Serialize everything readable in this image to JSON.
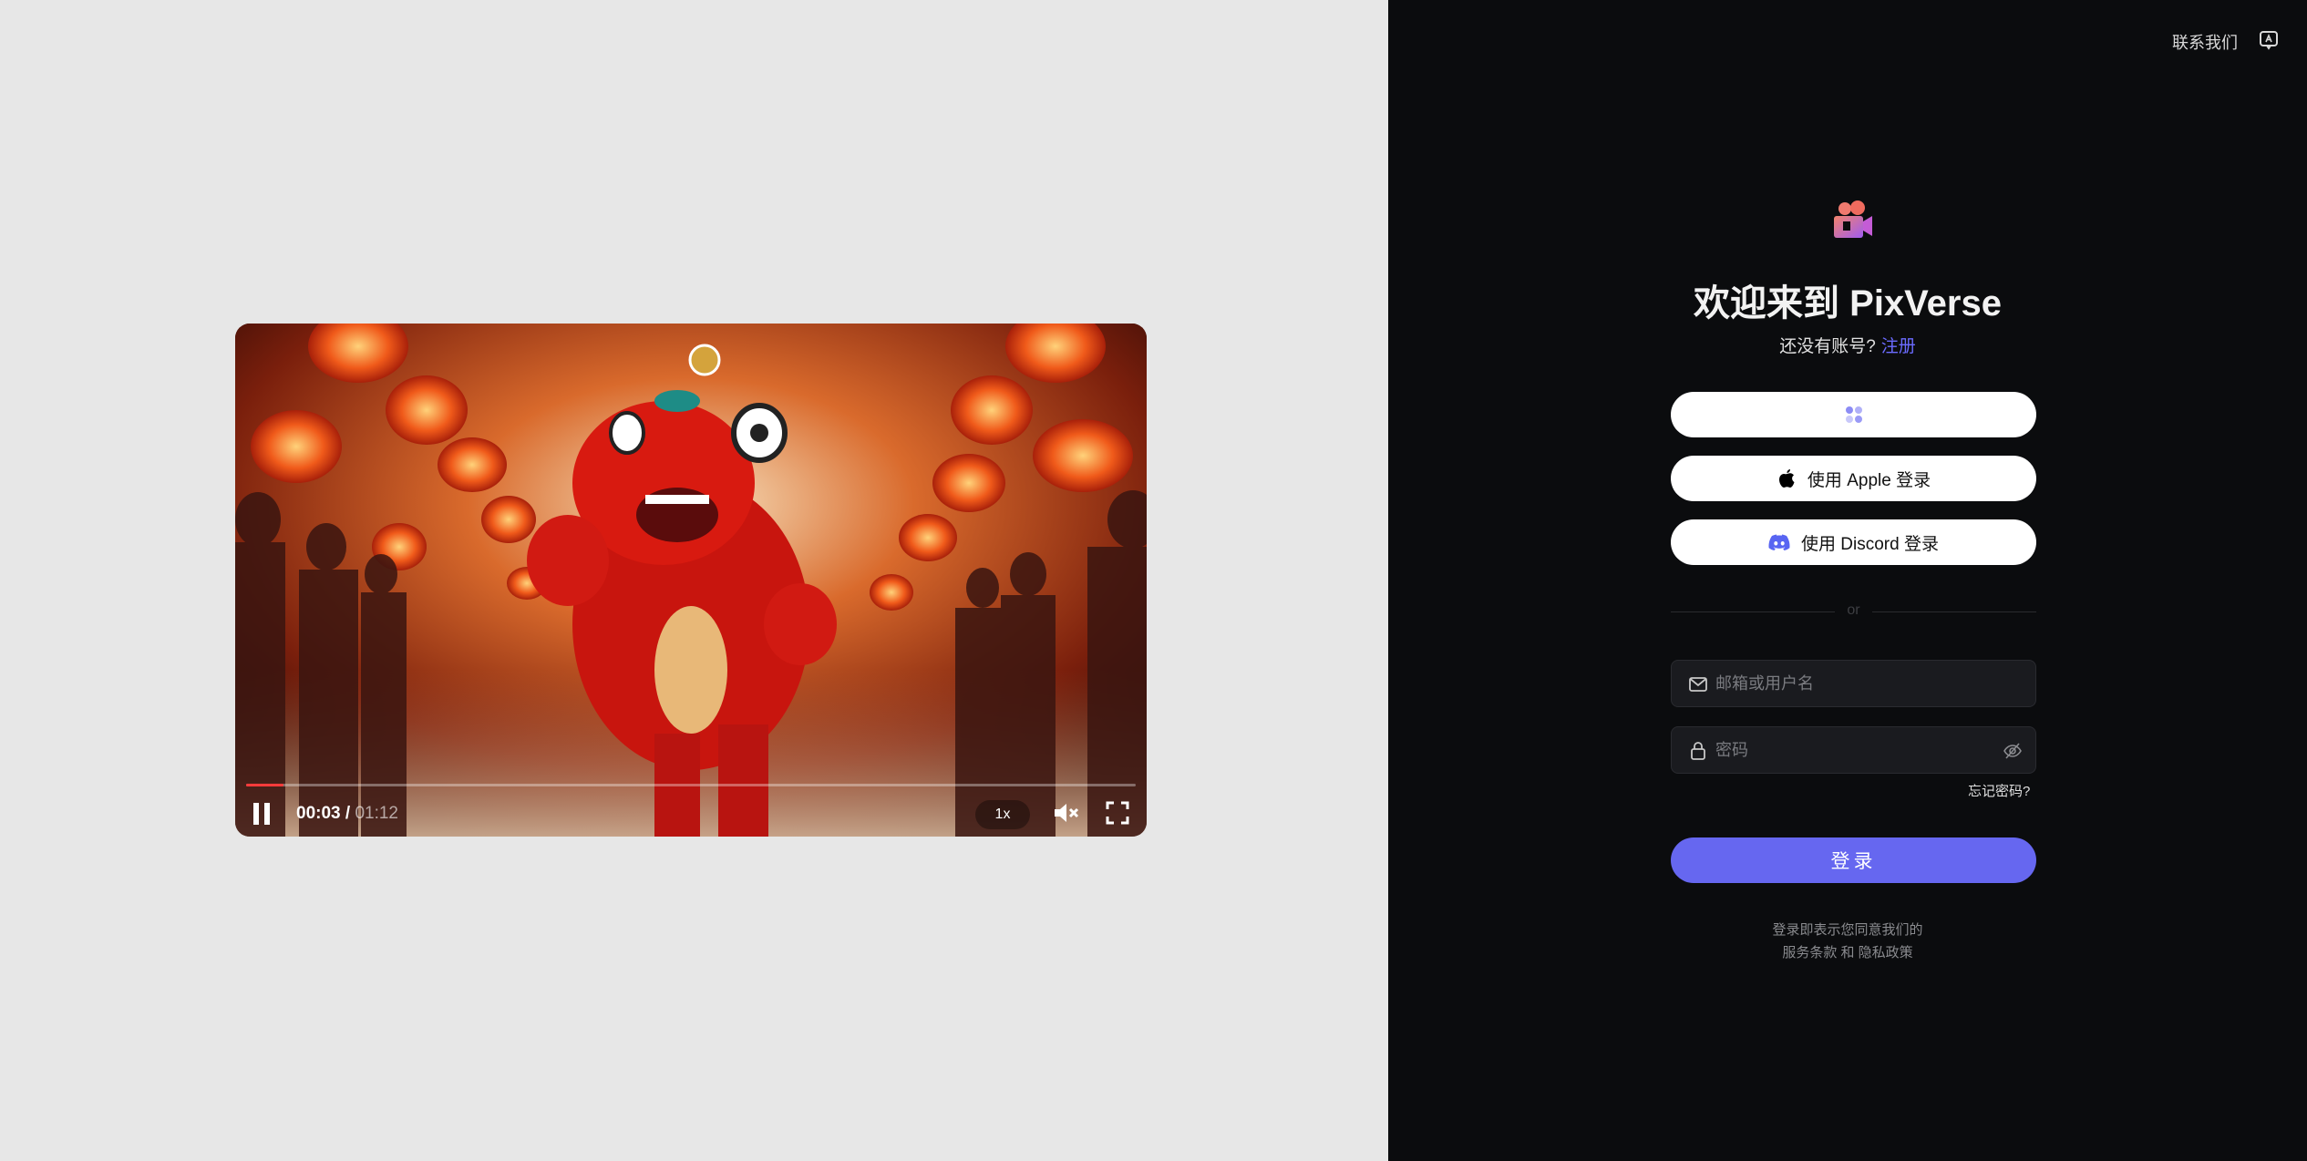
{
  "video": {
    "current_time": "00:03",
    "separator": " / ",
    "duration": "01:12",
    "speed": "1x",
    "progress": 0.042
  },
  "header": {
    "contact_label": "联系我们"
  },
  "auth": {
    "title": "欢迎来到 PixVerse",
    "no_account_text": "还没有账号?",
    "signup_link": "注册",
    "apple_button": "使用 Apple 登录",
    "discord_button": "使用 Discord 登录",
    "divider_text": "or",
    "email_placeholder": "邮箱或用户名",
    "password_placeholder": "密码",
    "forgot_password": "忘记密码?",
    "login_button": "登录",
    "terms_line1": "登录即表示您同意我们的",
    "terms_service": "服务条款",
    "terms_and": " 和 ",
    "terms_privacy": "隐私政策"
  },
  "colors": {
    "accent": "#6667f0",
    "link": "#6b6bff",
    "panel_bg": "#0b0c0e",
    "left_bg": "#e7e7e7",
    "progress": "#ff3b3b"
  },
  "icons": [
    "pixverse-logo-icon",
    "contact-chat-icon",
    "loading-dots-icon",
    "apple-icon",
    "discord-icon",
    "mail-icon",
    "lock-icon",
    "eye-off-icon",
    "pause-icon",
    "mute-icon",
    "fullscreen-icon"
  ]
}
